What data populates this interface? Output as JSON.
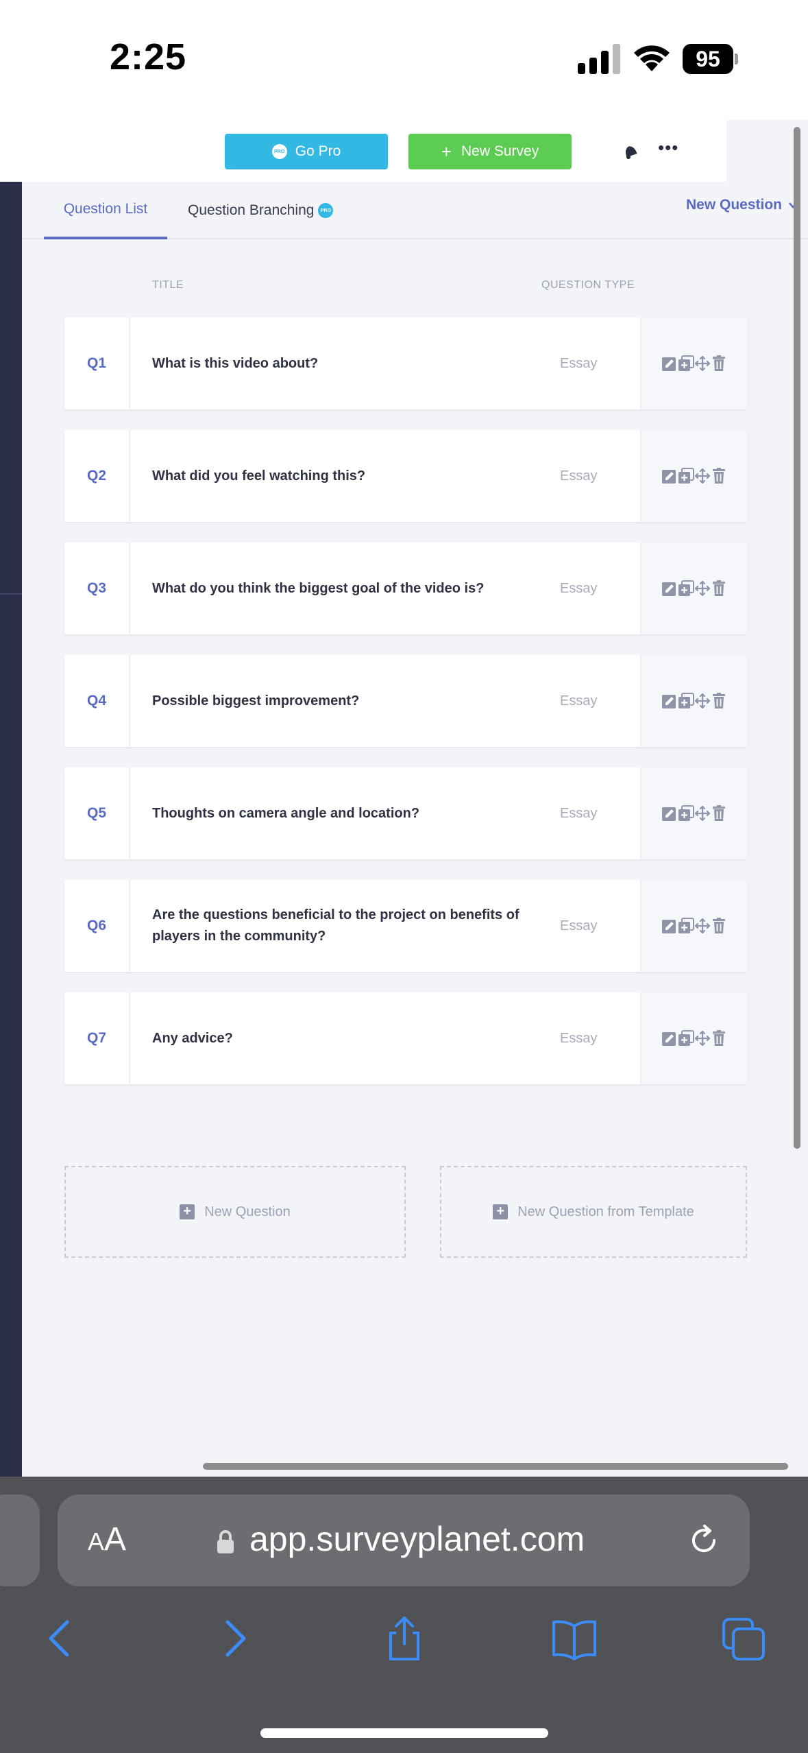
{
  "status_bar": {
    "time": "2:25",
    "battery": "95"
  },
  "topbar": {
    "go_pro_label": "Go Pro",
    "pro_badge": "PRO",
    "new_survey_label": "New Survey",
    "new_survey_plus": "+",
    "more_label": "•••"
  },
  "tabs": {
    "question_list": "Question List",
    "question_branching": "Question Branching",
    "pro_badge": "PRO",
    "new_question_menu": "New Question"
  },
  "table": {
    "headers": {
      "title": "TITLE",
      "question_type": "QUESTION TYPE"
    },
    "rows": [
      {
        "num": "Q1",
        "title": "What is this video about?",
        "type": "Essay"
      },
      {
        "num": "Q2",
        "title": "What did you feel watching this?",
        "type": "Essay"
      },
      {
        "num": "Q3",
        "title": "What do you think the biggest goal of the video is?",
        "type": "Essay"
      },
      {
        "num": "Q4",
        "title": "Possible biggest improvement?",
        "type": "Essay"
      },
      {
        "num": "Q5",
        "title": "Thoughts on camera angle and location?",
        "type": "Essay"
      },
      {
        "num": "Q6",
        "title": "Are the questions beneficial to the project on benefits of players in the community?",
        "type": "Essay"
      },
      {
        "num": "Q7",
        "title": "Any advice?",
        "type": "Essay"
      }
    ],
    "row_actions": [
      "edit-icon",
      "duplicate-icon",
      "move-icon",
      "delete-icon"
    ]
  },
  "add_buttons": {
    "plus": "+",
    "new_question": "New Question",
    "new_from_template": "New Question from Template"
  },
  "browser": {
    "aa_small": "A",
    "aa_large": "A",
    "url": "app.surveyplanet.com"
  },
  "colors": {
    "accent": "#5b6ac4",
    "go_pro": "#33b8e4",
    "new_survey": "#5ccc52",
    "sidebar": "#2c2f4a"
  }
}
